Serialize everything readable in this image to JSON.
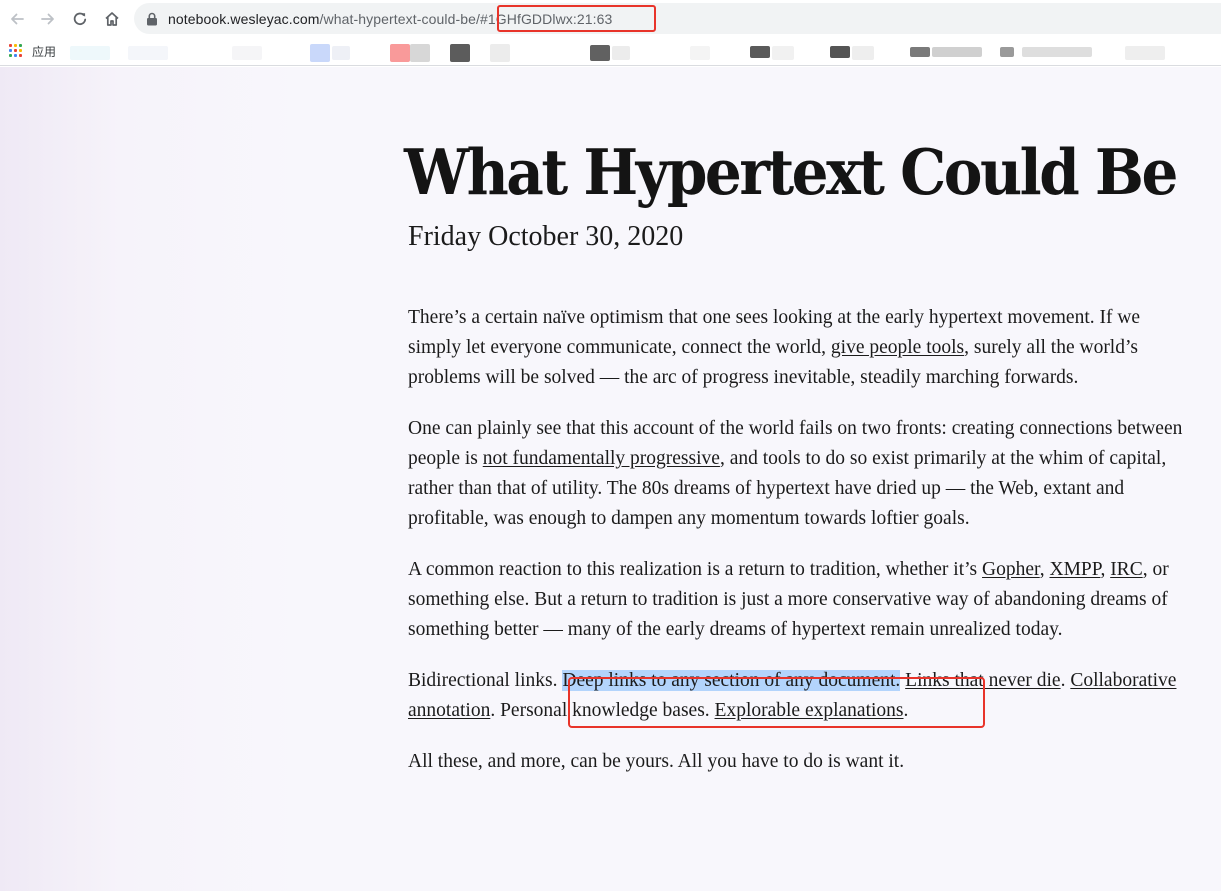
{
  "browser": {
    "url_host": "notebook.wesleyac.com",
    "url_path": "/what-hypertext-could-be/",
    "url_hash": "#1GHfGDDlwx:21:63",
    "bookmarks_apps_label": "应用",
    "icons": [
      "back-arrow-icon",
      "forward-arrow-icon",
      "reload-icon",
      "home-icon",
      "lock-icon",
      "apps-grid-icon"
    ]
  },
  "article": {
    "title": "What Hypertext Could Be",
    "date": "Friday October 30, 2020",
    "p1": {
      "t1": "There’s a certain naïve optimism that one sees looking at the early hypertext movement. If we simply let everyone communicate, connect the world, ",
      "link1": "give people tools",
      "t2": ", surely all the world’s problems will be solved — the arc of progress inevitable, steadily marching forwards."
    },
    "p2": {
      "t1": "One can plainly see that this account of the world fails on two fronts: creating connections between people is ",
      "link1": "not fundamentally progressive",
      "t2": ", and tools to do so exist primarily at the whim of capital, rather than that of utility. The 80s dreams of hypertext have dried up — the Web, extant and profitable, was enough to dampen any momentum towards loftier goals."
    },
    "p3": {
      "t1": "A common reaction to this realization is a return to tradition, whether it’s ",
      "link1": "Gopher",
      "t2": ", ",
      "link2": "XMPP",
      "t3": ", ",
      "link3": "IRC",
      "t4": ", or something else. But a return to tradition is just a more conservative way of abandoning dreams of something better — many of the early dreams of hypertext remain unrealized today."
    },
    "p4": {
      "t1": "Bidirectional links.",
      "sp": " ",
      "highlight": "Deep links to any section of any document.",
      "sp2": " ",
      "link1": "Links that never die",
      "t2": ". ",
      "link2": "Collaborative",
      "t3": " ",
      "link3": "annotation",
      "t4": ". Personal knowledge bases. ",
      "link4": "Explorable explanations",
      "t5": "."
    },
    "p5": "All these, and more, can be yours. All you have to do is want it."
  },
  "colors": {
    "annotation_red": "#e8342a",
    "selection_highlight": "#b3d4fc",
    "page_background": "#f8f7fc",
    "text": "#1b1b1b"
  }
}
